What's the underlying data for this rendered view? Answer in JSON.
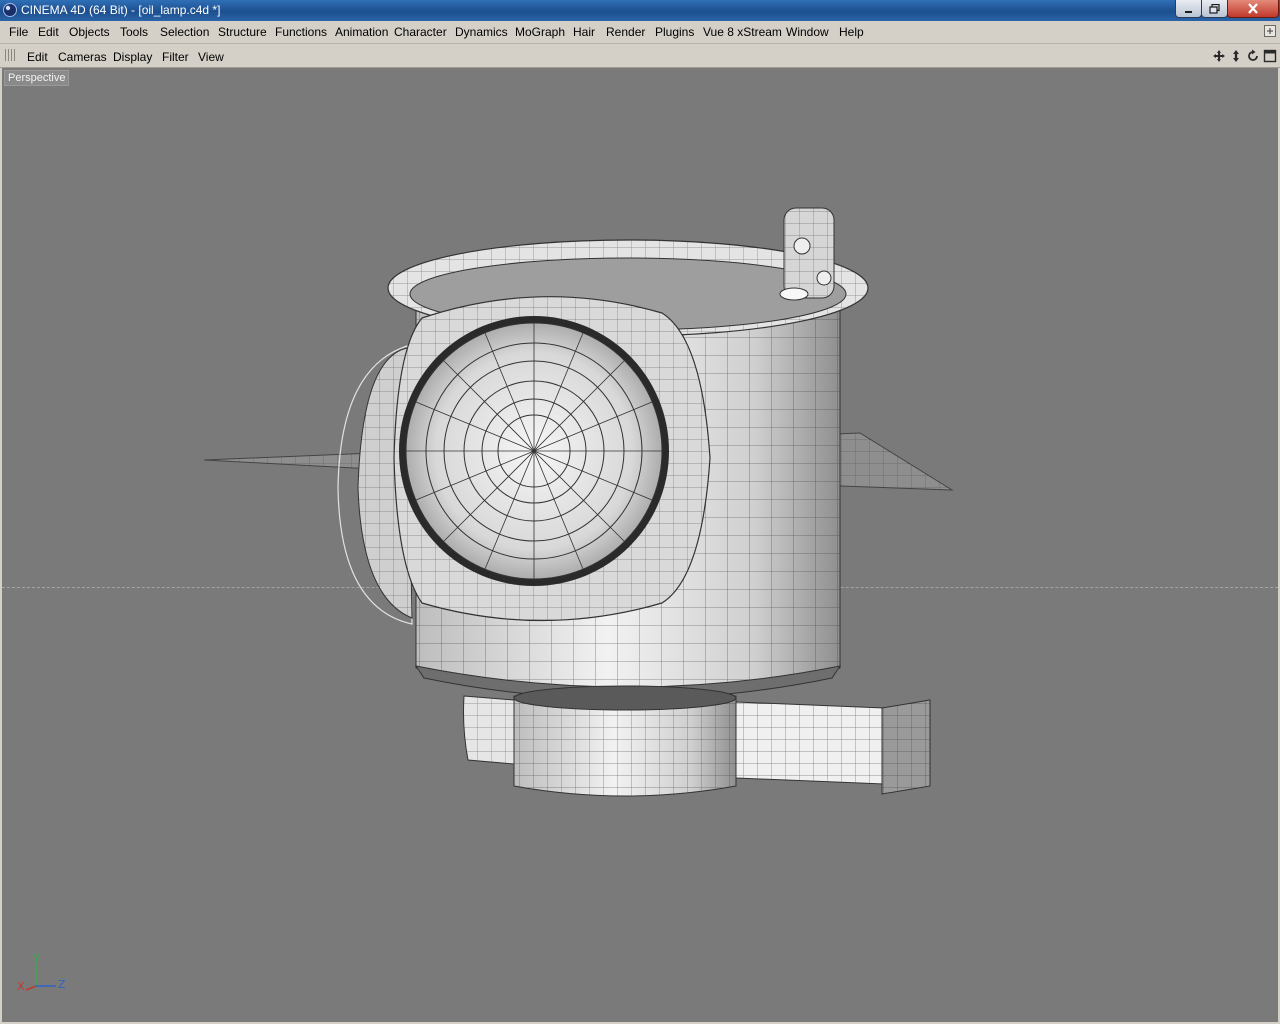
{
  "window": {
    "title": "CINEMA 4D (64 Bit) - [oil_lamp.c4d *]",
    "controls": {
      "minimize": "minimize",
      "maximize": "restore",
      "close": "close"
    }
  },
  "menubar": {
    "items": [
      "File",
      "Edit",
      "Objects",
      "Tools",
      "Selection",
      "Structure",
      "Functions",
      "Animation",
      "Character",
      "Dynamics",
      "MoGraph",
      "Hair",
      "Render",
      "Plugins",
      "Vue 8 xStream",
      "Window",
      "Help"
    ]
  },
  "viewport_toolbar": {
    "items": [
      "Edit",
      "Cameras",
      "Display",
      "Filter",
      "View"
    ],
    "nav_icons": [
      "move-view-icon",
      "zoom-view-icon",
      "rotate-view-icon",
      "maximize-view-icon"
    ]
  },
  "viewport": {
    "label": "Perspective",
    "background": "#7a7a7a",
    "axis": {
      "x": "X",
      "y": "Y",
      "z": "Z"
    },
    "axis_colors": {
      "x": "#c0392b",
      "y": "#3aa84a",
      "z": "#2f64c8"
    }
  },
  "colors": {
    "titlebar": "#1d4f8f",
    "chrome": "#d4d0c8",
    "mesh_fill": "#dcdcdc",
    "wire": "#3a3a3a"
  }
}
